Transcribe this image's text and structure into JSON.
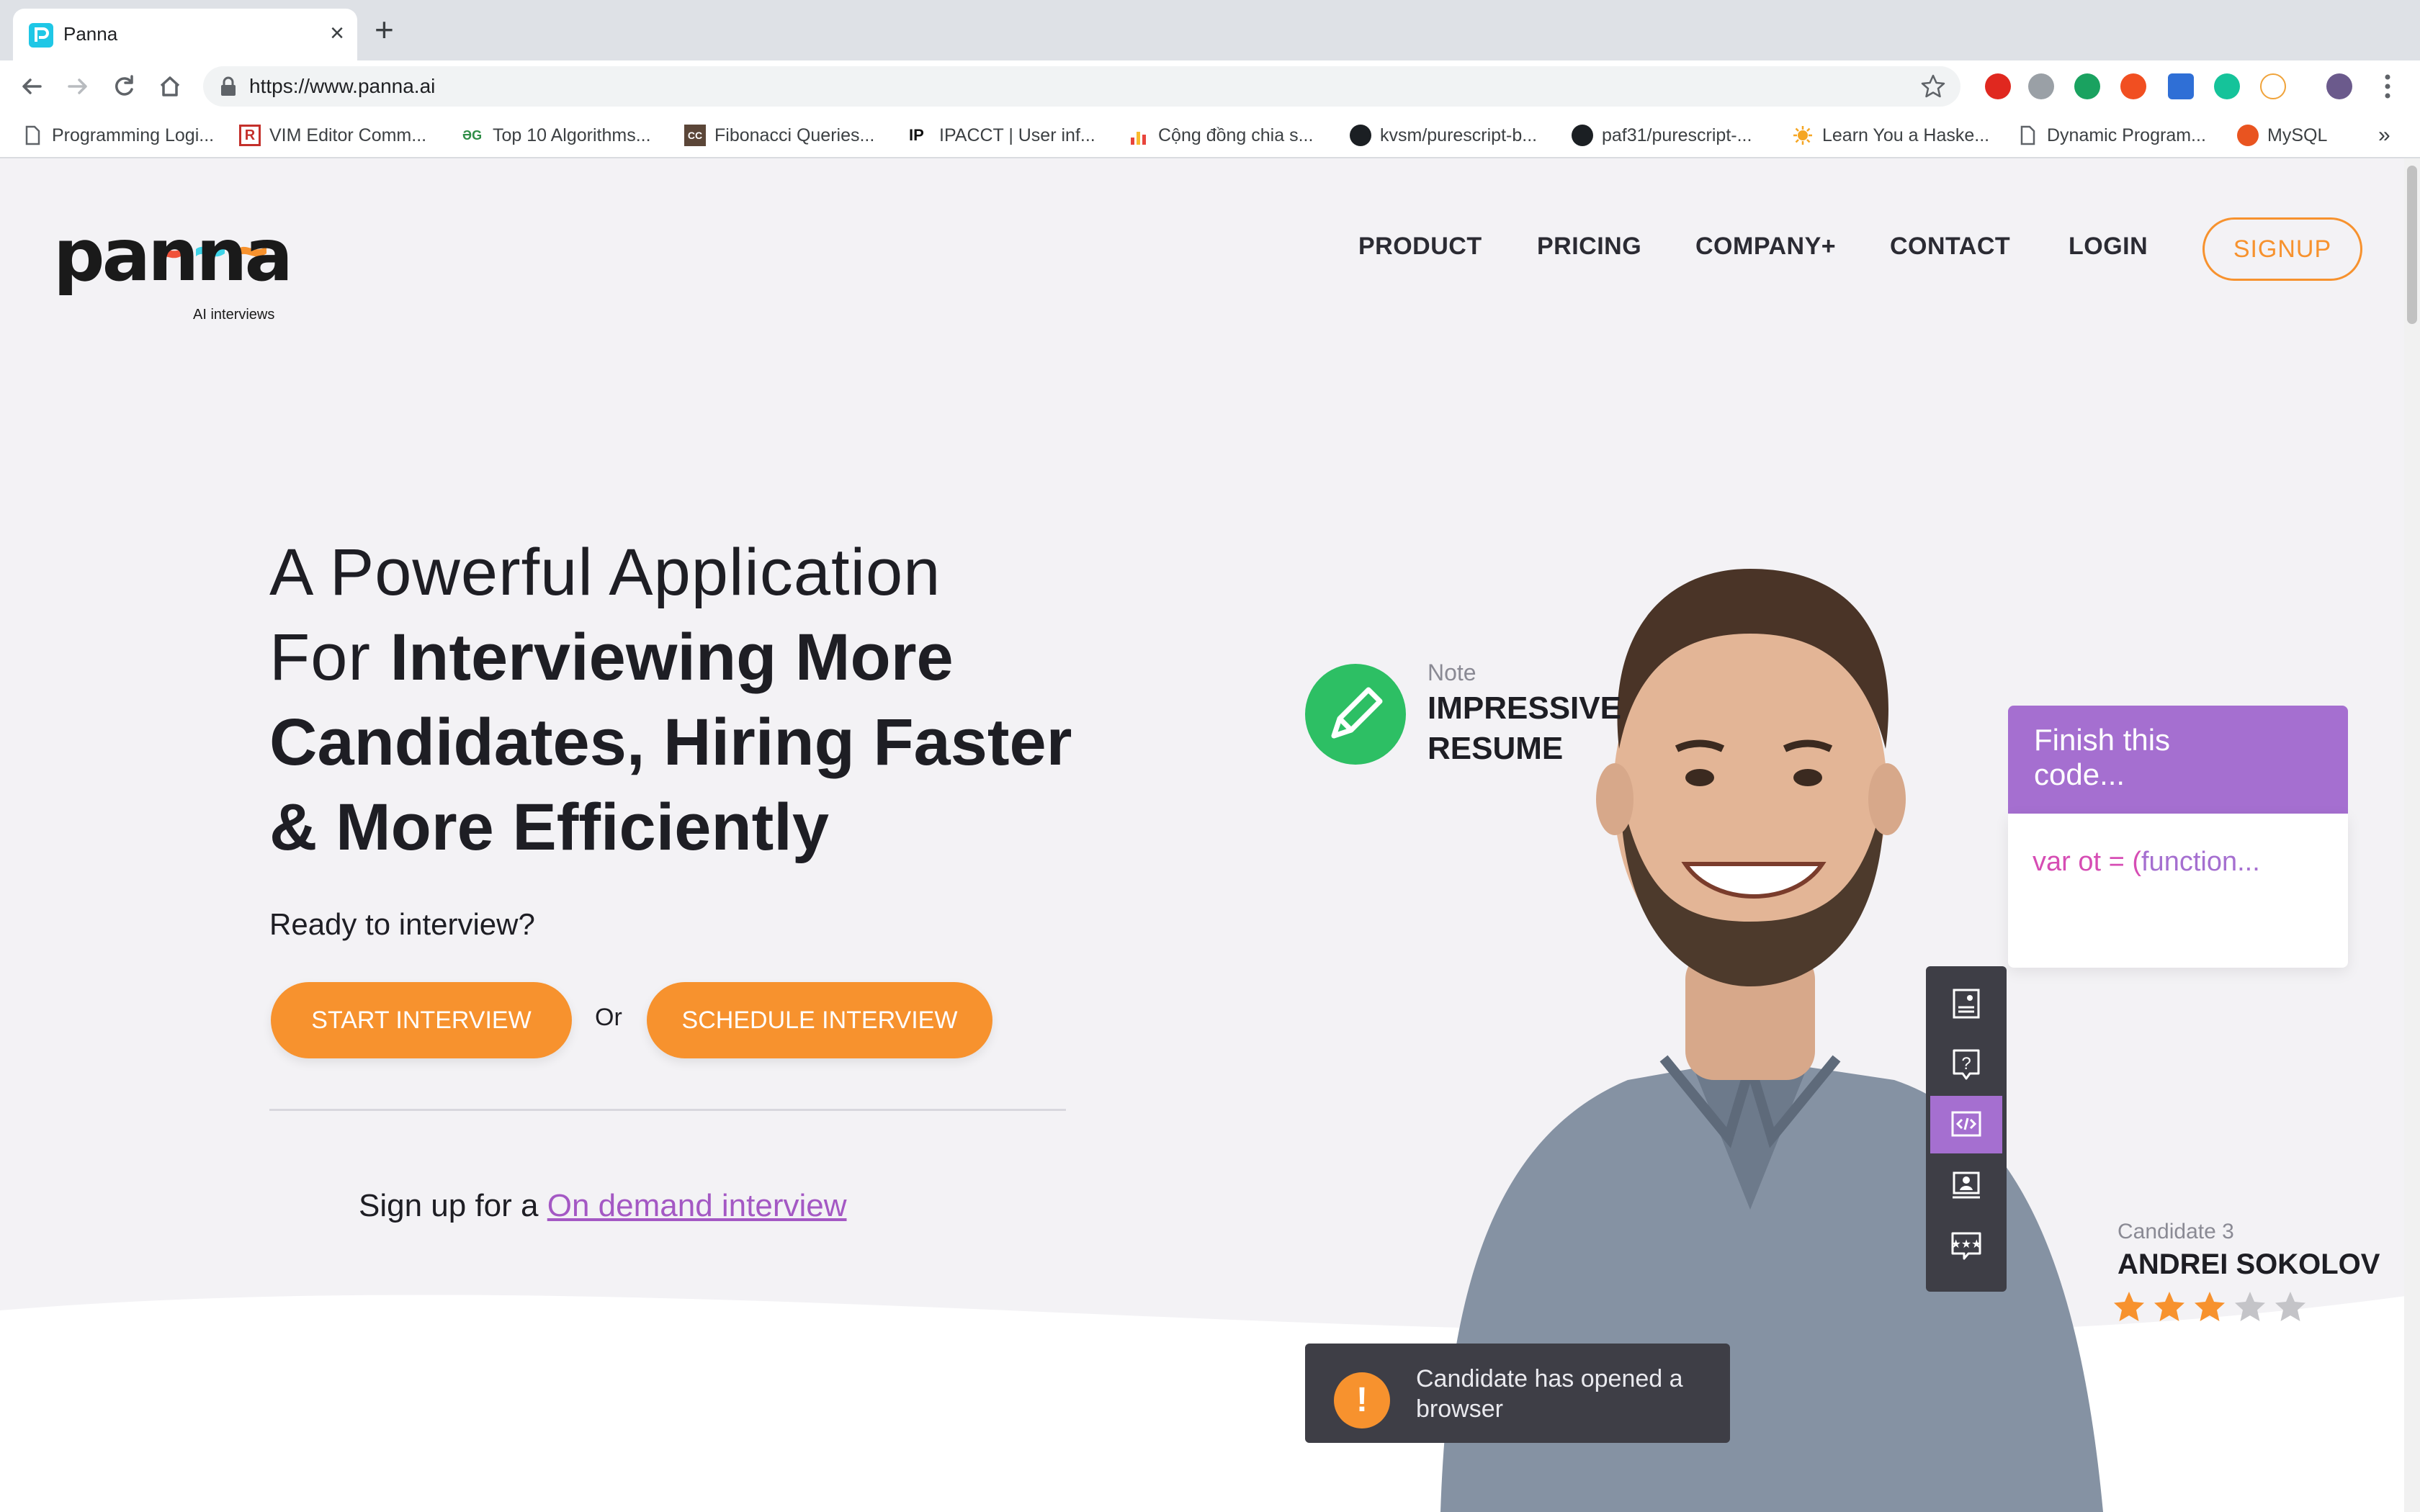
{
  "browser": {
    "tab_title": "Panna",
    "url": "https://www.panna.ai",
    "bookmarks": [
      {
        "label": "Programming Logi...",
        "icon": "page-icon"
      },
      {
        "label": "VIM Editor Comm...",
        "icon": "r-logo-icon"
      },
      {
        "label": "Top 10 Algorithms...",
        "icon": "dg-logo-icon"
      },
      {
        "label": "Fibonacci Queries...",
        "icon": "cc-logo-icon"
      },
      {
        "label": "IPACCT | User inf...",
        "icon": "ip-logo-icon"
      },
      {
        "label": "Cộng đồng chia s...",
        "icon": "bar-chart-icon"
      },
      {
        "label": "kvsm/purescript-b...",
        "icon": "github-icon"
      },
      {
        "label": "paf31/purescript-...",
        "icon": "github-icon"
      },
      {
        "label": "Learn You a Haske...",
        "icon": "sun-icon"
      },
      {
        "label": "Dynamic Program...",
        "icon": "page-icon"
      },
      {
        "label": "MySQL",
        "icon": "ubuntu-icon"
      }
    ],
    "overflow": "»"
  },
  "site": {
    "logo_word": "panna",
    "logo_sub": "AI interviews",
    "nav": {
      "product": "PRODUCT",
      "pricing": "PRICING",
      "company": "COMPANY+",
      "contact": "CONTACT",
      "login": "LOGIN",
      "signup": "SIGNUP"
    },
    "hero": {
      "line1": "A Powerful Application",
      "line2_light": "For ",
      "line2_bold": "Interviewing More",
      "line3": "Candidates, Hiring Faster",
      "line4": "& More Efficiently"
    },
    "ready": "Ready to interview?",
    "start_interview": "START INTERVIEW",
    "or": "Or",
    "schedule_interview": "SCHEDULE INTERVIEW",
    "signup_prefix": "Sign up for a ",
    "signup_link": "On demand interview",
    "note_label": "Note",
    "note_line1": "IMPRESSIVE",
    "note_line2": "RESUME",
    "code_prompt_line1": "Finish this",
    "code_prompt_line2": "code...",
    "code_snippet_var": "var ot = (",
    "code_snippet_fn": "function...",
    "candidate_label": "Candidate 3",
    "candidate_name": "ANDREI SOKOLOV",
    "rating": 3,
    "rating_max": 5,
    "toast_text": "Candidate has opened a browser",
    "colors": {
      "accent": "#f7922e",
      "purple": "#a56fd0",
      "green": "#2dbf64",
      "link": "#a458c4"
    }
  }
}
